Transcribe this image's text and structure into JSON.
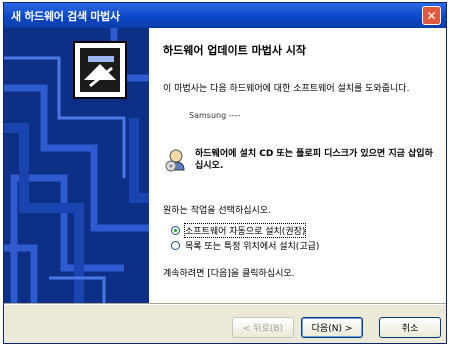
{
  "window": {
    "title": "새 하드웨어 검색 마법사"
  },
  "wizard": {
    "heading": "하드웨어 업데이트 마법사 시작",
    "intro": "이 마법사는 다음 하드웨어에 대한 소프트웨어 설치를 도와줍니다.",
    "device": "Samsung ----",
    "cd_prompt": "하드웨어에 설치 CD 또는 플로피 디스크가 있으면 지금 삽입하십시오.",
    "question": "원하는 작업을 선택하십시오.",
    "options": [
      {
        "label": "소프트웨어 자동으로 설치(권장)",
        "selected": true
      },
      {
        "label": "목록 또는 특정 위치에서 설치(고급)",
        "selected": false
      }
    ],
    "hint": "계속하려면 [다음]을 클릭하십시오."
  },
  "footer": {
    "back_label": "< 뒤로(B)",
    "next_label": "다음(N) >",
    "cancel_label": "취소"
  },
  "colors": {
    "titlebar": "#0a47c9",
    "sidepanel": "#0d2f86",
    "accent": "#21a121"
  }
}
